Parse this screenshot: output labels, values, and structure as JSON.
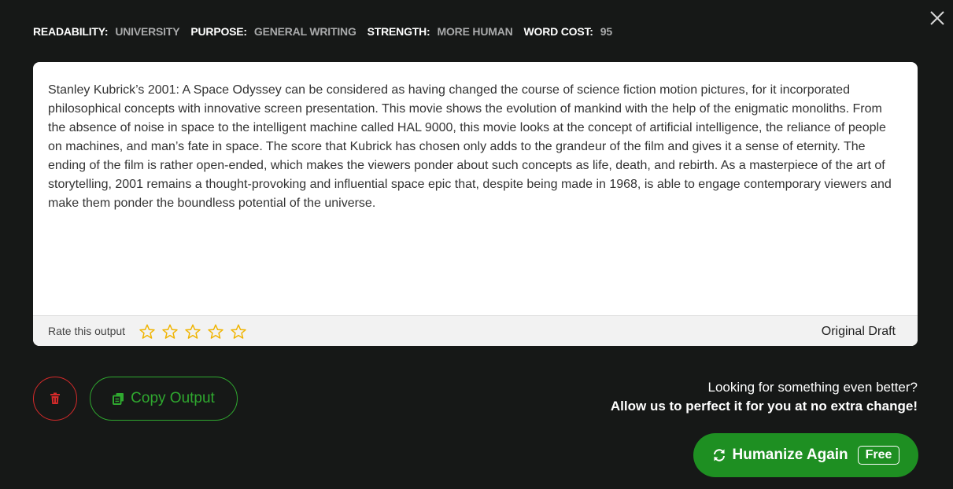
{
  "meta": {
    "readability_label": "READABILITY:",
    "readability_value": "UNIVERSITY",
    "purpose_label": "PURPOSE:",
    "purpose_value": "GENERAL WRITING",
    "strength_label": "STRENGTH:",
    "strength_value": "MORE HUMAN",
    "word_cost_label": "WORD COST:",
    "word_cost_value": "95"
  },
  "output": {
    "text": "Stanley Kubrick’s 2001: A Space Odyssey can be considered as having changed the course of science fiction motion pictures, for it incorporated philosophical concepts with innovative screen presentation. This movie shows the evolution of mankind with the help of the enigmatic monoliths. From the absence of noise in space to the intelligent machine called HAL 9000, this movie looks at the concept of artificial intelligence, the reliance of people on machines, and man’s fate in space. The score that Kubrick has chosen only adds to the grandeur of the film and gives it a sense of eternity. The ending of the film is rather open-ended, which makes the viewers ponder about such concepts as life, death, and rebirth. As a masterpiece of the art of storytelling, 2001 remains a thought-provoking and influential space epic that, despite being made in 1968, is able to engage contemporary viewers and make them ponder the boundless potential of the universe.",
    "rate_label": "Rate this output",
    "rating_stars_total": 5,
    "rating_value": 0,
    "draft_label": "Original Draft"
  },
  "actions": {
    "copy_label": "Copy Output",
    "promo_line1": "Looking for something even better?",
    "promo_line2": "Allow us to perfect it for you at no extra change!",
    "humanize_label": "Humanize Again",
    "free_badge": "Free"
  },
  "colors": {
    "background": "#161817",
    "accent_green": "#1e8f22",
    "danger_red": "#d42a2a",
    "star_yellow": "#f0b400"
  },
  "icons": [
    "close-icon",
    "star-icon",
    "trash-icon",
    "copy-icon",
    "refresh-icon"
  ]
}
